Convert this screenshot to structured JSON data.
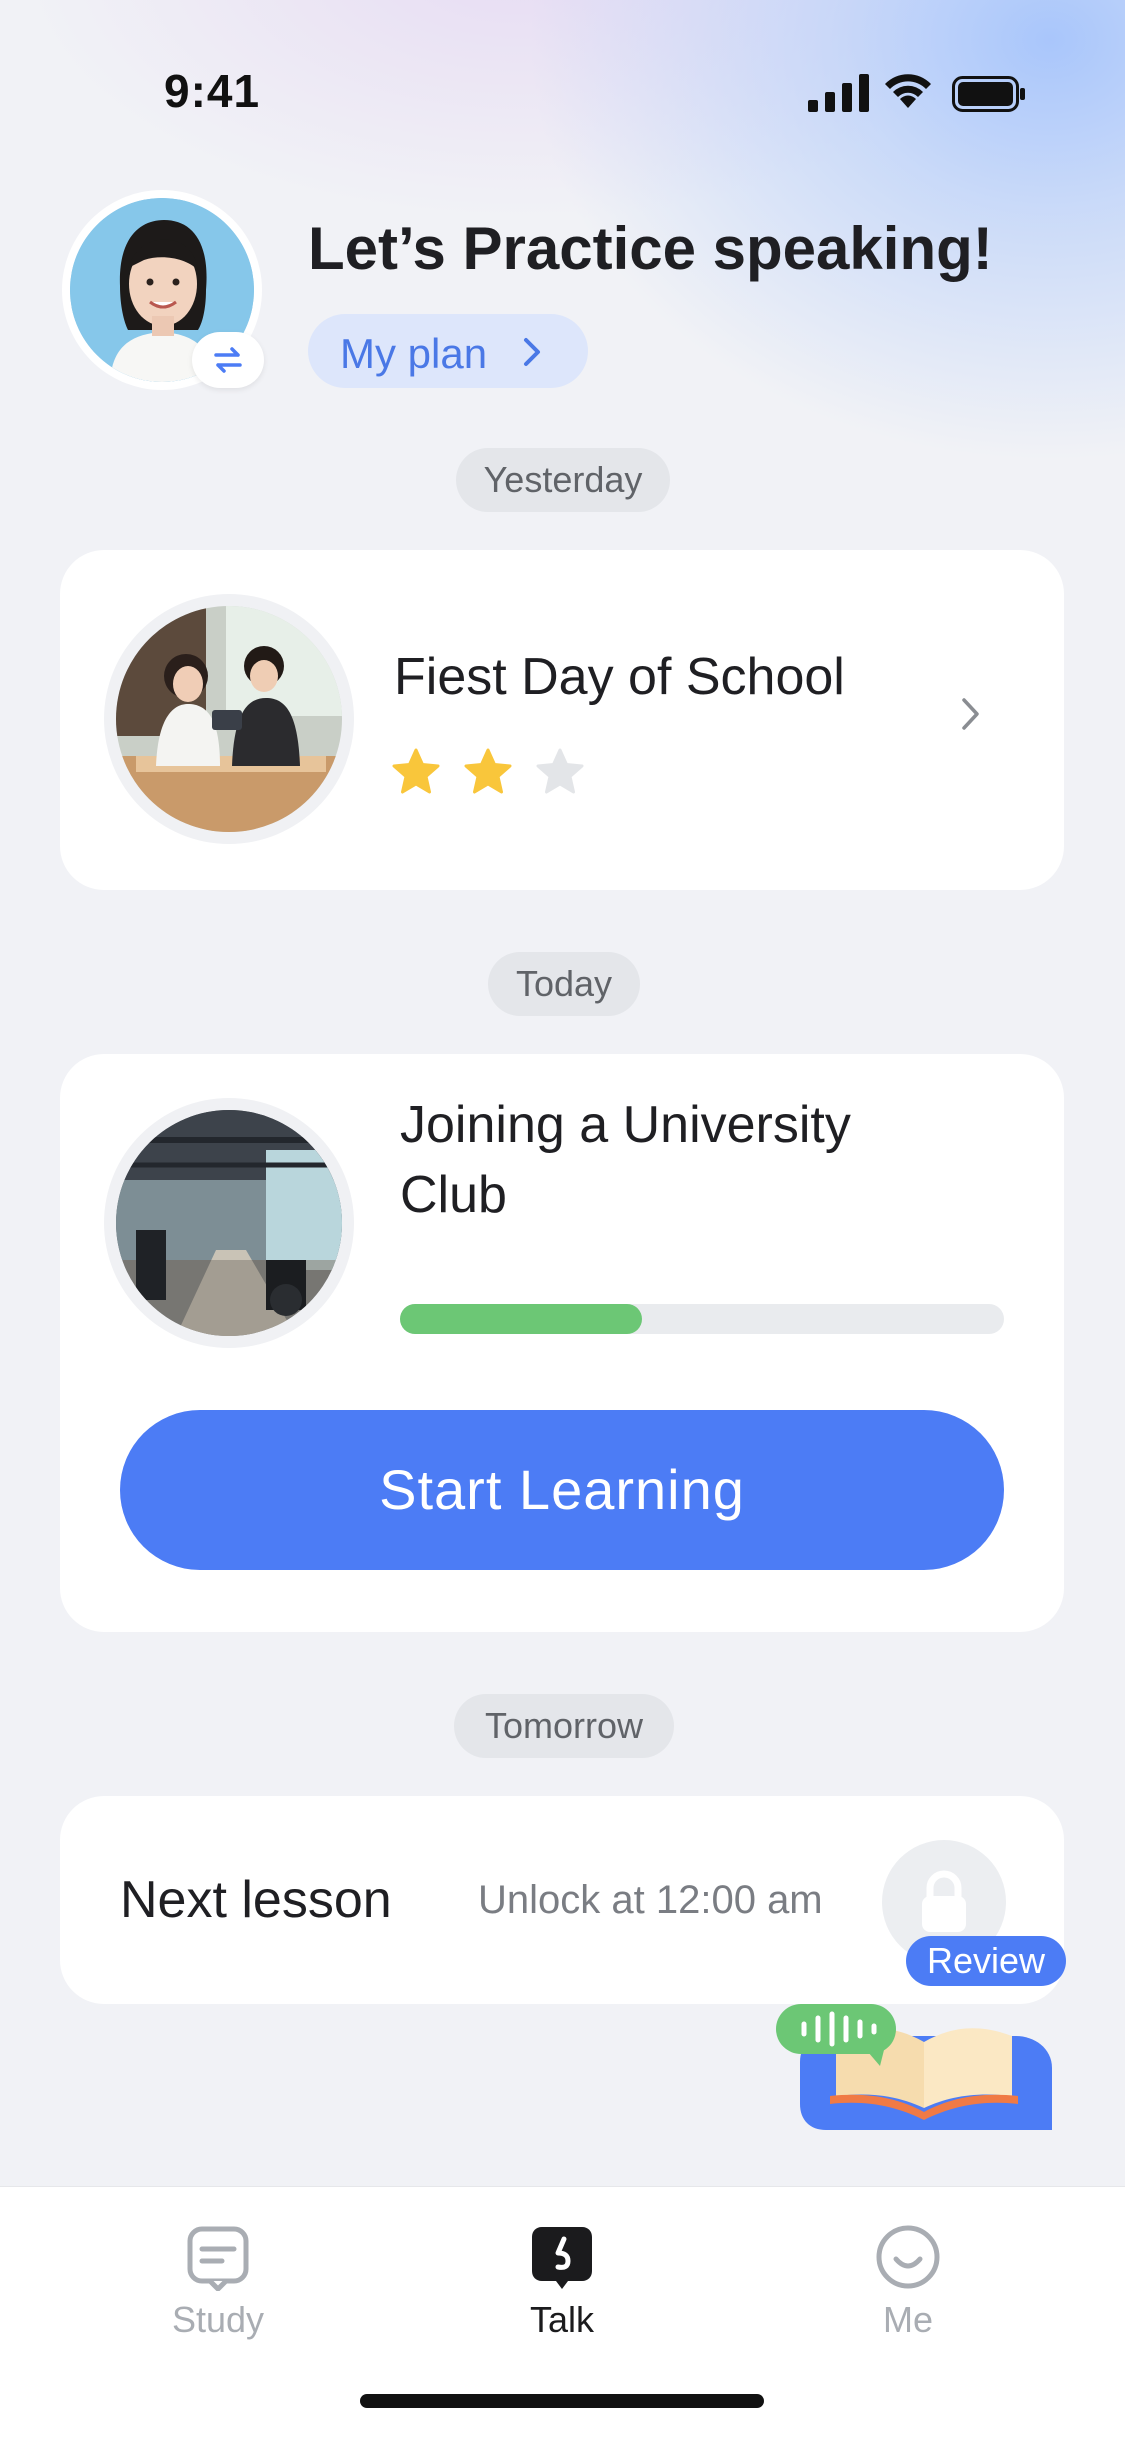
{
  "status_bar": {
    "time": "9:41",
    "icons": [
      "cellular-signal-icon",
      "wifi-icon",
      "battery-icon"
    ]
  },
  "header": {
    "title": "Let’s Practice speaking!",
    "plan_label": "My plan",
    "avatar_icon": "switch-arrows-icon"
  },
  "days": {
    "yesterday": "Yesterday",
    "today": "Today",
    "tomorrow": "Tomorrow"
  },
  "lessons": {
    "yesterday": {
      "title": "Fiest Day of School",
      "stars": 2,
      "max_stars": 3
    },
    "today": {
      "title_line1": "Joining a University",
      "title_line2": "Club",
      "progress": 0.4,
      "button_label": "Start Learning"
    },
    "tomorrow": {
      "label": "Next lesson",
      "unlock_text": "Unlock at 12:00 am",
      "icon": "lock-icon"
    }
  },
  "review": {
    "label": "Review"
  },
  "tabs": [
    {
      "label": "Study",
      "icon": "study-icon",
      "active": false
    },
    {
      "label": "Talk",
      "icon": "talk-icon",
      "active": true
    },
    {
      "label": "Me",
      "icon": "smiley-icon",
      "active": false
    }
  ],
  "colors": {
    "accent": "#4c7cf5",
    "progress": "#6cc775",
    "star_filled": "#f9c63b",
    "star_empty": "#e3e5e8"
  }
}
